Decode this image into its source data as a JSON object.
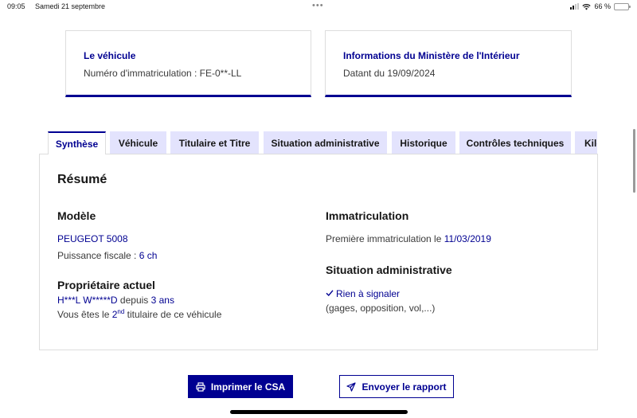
{
  "status_bar": {
    "time": "09:05",
    "date": "Samedi 21 septembre",
    "dots": "•••",
    "battery": "66 %",
    "battery_level": 0.66
  },
  "cards": {
    "vehicle": {
      "title": "Le véhicule",
      "text": "Numéro d'immatriculation : FE-0**-LL"
    },
    "ministry": {
      "title": "Informations du Ministère de l'Intérieur",
      "text": "Datant du 19/09/2024"
    }
  },
  "tabs": [
    {
      "label": "Synthèse",
      "active": true
    },
    {
      "label": "Véhicule",
      "active": false
    },
    {
      "label": "Titulaire et Titre",
      "active": false
    },
    {
      "label": "Situation administrative",
      "active": false
    },
    {
      "label": "Historique",
      "active": false
    },
    {
      "label": "Contrôles techniques",
      "active": false
    },
    {
      "label": "Kilo",
      "active": false
    }
  ],
  "summary": {
    "title": "Résumé",
    "model": {
      "heading": "Modèle",
      "name": "PEUGEOT 5008",
      "fiscal_label": "Puissance fiscale : ",
      "fiscal_value": "6 ch"
    },
    "owner": {
      "heading": "Propriétaire actuel",
      "name": "H***L W*****D",
      "since_label": " depuis ",
      "since_value": "3 ans",
      "rank_prefix": "Vous êtes le ",
      "rank_number": "2",
      "rank_suffix": "nd",
      "rank_end": " titulaire de ce véhicule"
    },
    "registration": {
      "heading": "Immatriculation",
      "label": "Première immatriculation le ",
      "date": "11/03/2019"
    },
    "admin": {
      "heading": "Situation administrative",
      "status": "Rien à signaler",
      "note": "(gages, opposition, vol,...)"
    }
  },
  "actions": {
    "print": "Imprimer le CSA",
    "send": "Envoyer le rapport"
  },
  "colors": {
    "accent": "#000091",
    "tab_bg": "#e3e3fd"
  }
}
